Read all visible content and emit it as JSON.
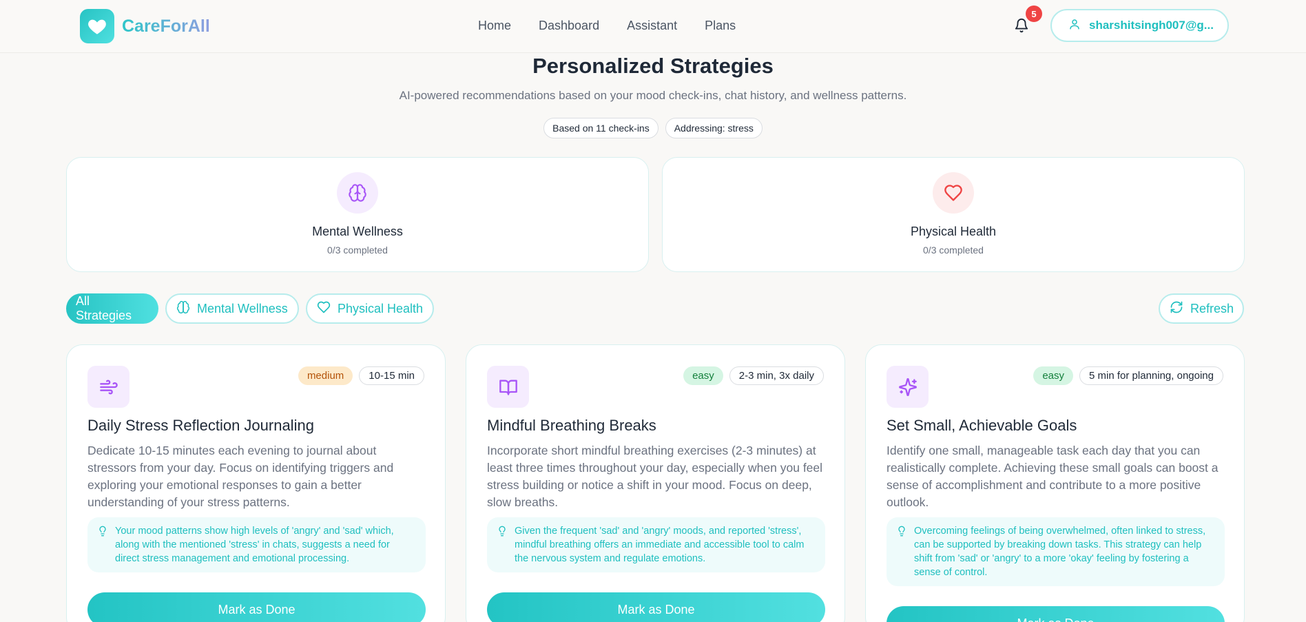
{
  "brand": {
    "name": "CareForAll"
  },
  "nav": {
    "items": [
      "Home",
      "Dashboard",
      "Assistant",
      "Plans"
    ]
  },
  "notifications": {
    "count": "5"
  },
  "user": {
    "email": "sharshitsingh007@g..."
  },
  "hero": {
    "title": "Personalized Strategies",
    "subtitle": "AI-powered recommendations based on your mood check-ins, chat history, and wellness patterns.",
    "pills": [
      "Based on 11 check-ins",
      "Addressing: stress"
    ]
  },
  "categories": [
    {
      "title": "Mental Wellness",
      "progress": "0/3 completed",
      "icon": "brain-icon",
      "color": "#a855f7"
    },
    {
      "title": "Physical Health",
      "progress": "0/3 completed",
      "icon": "heart-icon",
      "color": "#ef4444"
    }
  ],
  "filters": {
    "all": "All Strategies",
    "mental": "Mental Wellness",
    "physical": "Physical Health",
    "refresh": "Refresh"
  },
  "strategies": [
    {
      "icon": "wind-icon",
      "difficulty": "medium",
      "time": "10-15 min",
      "title": "Daily Stress Reflection Journaling",
      "description": "Dedicate 10-15 minutes each evening to journal about stressors from your day. Focus on identifying triggers and exploring your emotional responses to gain a better understanding of your stress patterns.",
      "reason": "Your mood patterns show high levels of 'angry' and 'sad' which, along with the mentioned 'stress' in chats, suggests a need for direct stress management and emotional processing.",
      "action": "Mark as Done"
    },
    {
      "icon": "book-icon",
      "difficulty": "easy",
      "time": "2-3 min, 3x daily",
      "title": "Mindful Breathing Breaks",
      "description": "Incorporate short mindful breathing exercises (2-3 minutes) at least three times throughout your day, especially when you feel stress building or notice a shift in your mood. Focus on deep, slow breaths.",
      "reason": "Given the frequent 'sad' and 'angry' moods, and reported 'stress', mindful breathing offers an immediate and accessible tool to calm the nervous system and regulate emotions.",
      "action": "Mark as Done"
    },
    {
      "icon": "sparkles-icon",
      "difficulty": "easy",
      "time": "5 min for planning, ongoing",
      "title": "Set Small, Achievable Goals",
      "description": "Identify one small, manageable task each day that you can realistically complete. Achieving these small goals can boost a sense of accomplishment and contribute to a more positive outlook.",
      "reason": "Overcoming feelings of being overwhelmed, often linked to stress, can be supported by breaking down tasks. This strategy can help shift from 'sad' or 'angry' to a more 'okay' feeling by fostering a sense of control.",
      "action": "Mark as Done"
    }
  ]
}
